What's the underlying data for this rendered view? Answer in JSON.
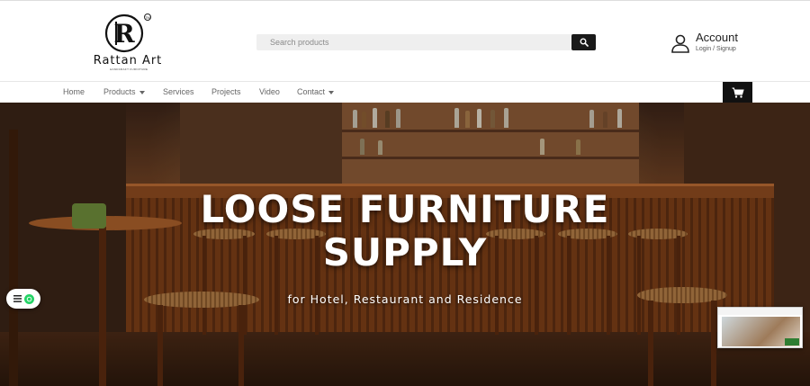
{
  "brand": {
    "name": "Rattan Art",
    "tagline": "HANDCRAFT FURNITURE",
    "tm": "TM",
    "monogram": "R"
  },
  "search": {
    "placeholder": "Search products",
    "icon": "search-icon"
  },
  "account": {
    "title": "Account",
    "subtitle": "Login / Signup",
    "icon": "user-icon"
  },
  "nav": {
    "items": [
      {
        "label": "Home",
        "dropdown": false
      },
      {
        "label": "Products",
        "dropdown": true
      },
      {
        "label": "Services",
        "dropdown": false
      },
      {
        "label": "Projects",
        "dropdown": false
      },
      {
        "label": "Video",
        "dropdown": false
      },
      {
        "label": "Contact",
        "dropdown": true
      }
    ],
    "cart_icon": "cart-icon"
  },
  "hero": {
    "title_line1": "LOOSE FURNITURE",
    "title_line2": "SUPPLY",
    "subtitle": "for Hotel, Restaurant and Residence"
  },
  "floating": {
    "menu_icon": "menu-icon",
    "chat_icon": "whatsapp-icon"
  },
  "colors": {
    "accent_dark": "#111111",
    "whatsapp": "#25d366",
    "hero_text": "#ffffff"
  }
}
